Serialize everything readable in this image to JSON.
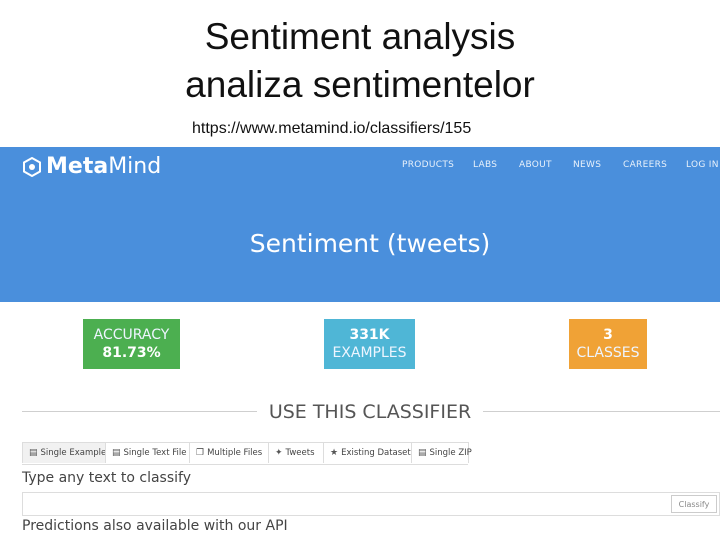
{
  "slide": {
    "title_line1": "Sentiment analysis",
    "title_line2": "analiza sentimentelor",
    "url": "https://www.metamind.io/classifiers/155"
  },
  "site": {
    "logo_meta": "Meta",
    "logo_mind": "Mind",
    "nav": [
      "PRODUCTS",
      "LABS",
      "ABOUT",
      "NEWS",
      "CAREERS",
      "LOG IN"
    ],
    "hero_title": "Sentiment (tweets)",
    "colors": {
      "hero": "#4a8fdc",
      "accuracy": "#4caf50",
      "examples": "#4fb6d6",
      "classes": "#f0a236"
    }
  },
  "stats": {
    "accuracy_label": "ACCURACY",
    "accuracy_value": "81.73%",
    "examples_value": "331K",
    "examples_label": "EXAMPLES",
    "classes_value": "3",
    "classes_label": "CLASSES"
  },
  "classifier": {
    "section_title": "USE THIS CLASSIFIER",
    "tabs": [
      {
        "label": "Single Example",
        "icon": "document-icon"
      },
      {
        "label": "Single Text File",
        "icon": "file-icon"
      },
      {
        "label": "Multiple Files",
        "icon": "files-icon"
      },
      {
        "label": "Tweets",
        "icon": "twitter-icon"
      },
      {
        "label": "Existing Dataset",
        "icon": "star-icon"
      },
      {
        "label": "Single ZIP",
        "icon": "zip-icon"
      }
    ],
    "prompt": "Type any text to classify",
    "input_value": "",
    "classify_button": "Classify",
    "api_note": "Predictions also available with our API"
  }
}
